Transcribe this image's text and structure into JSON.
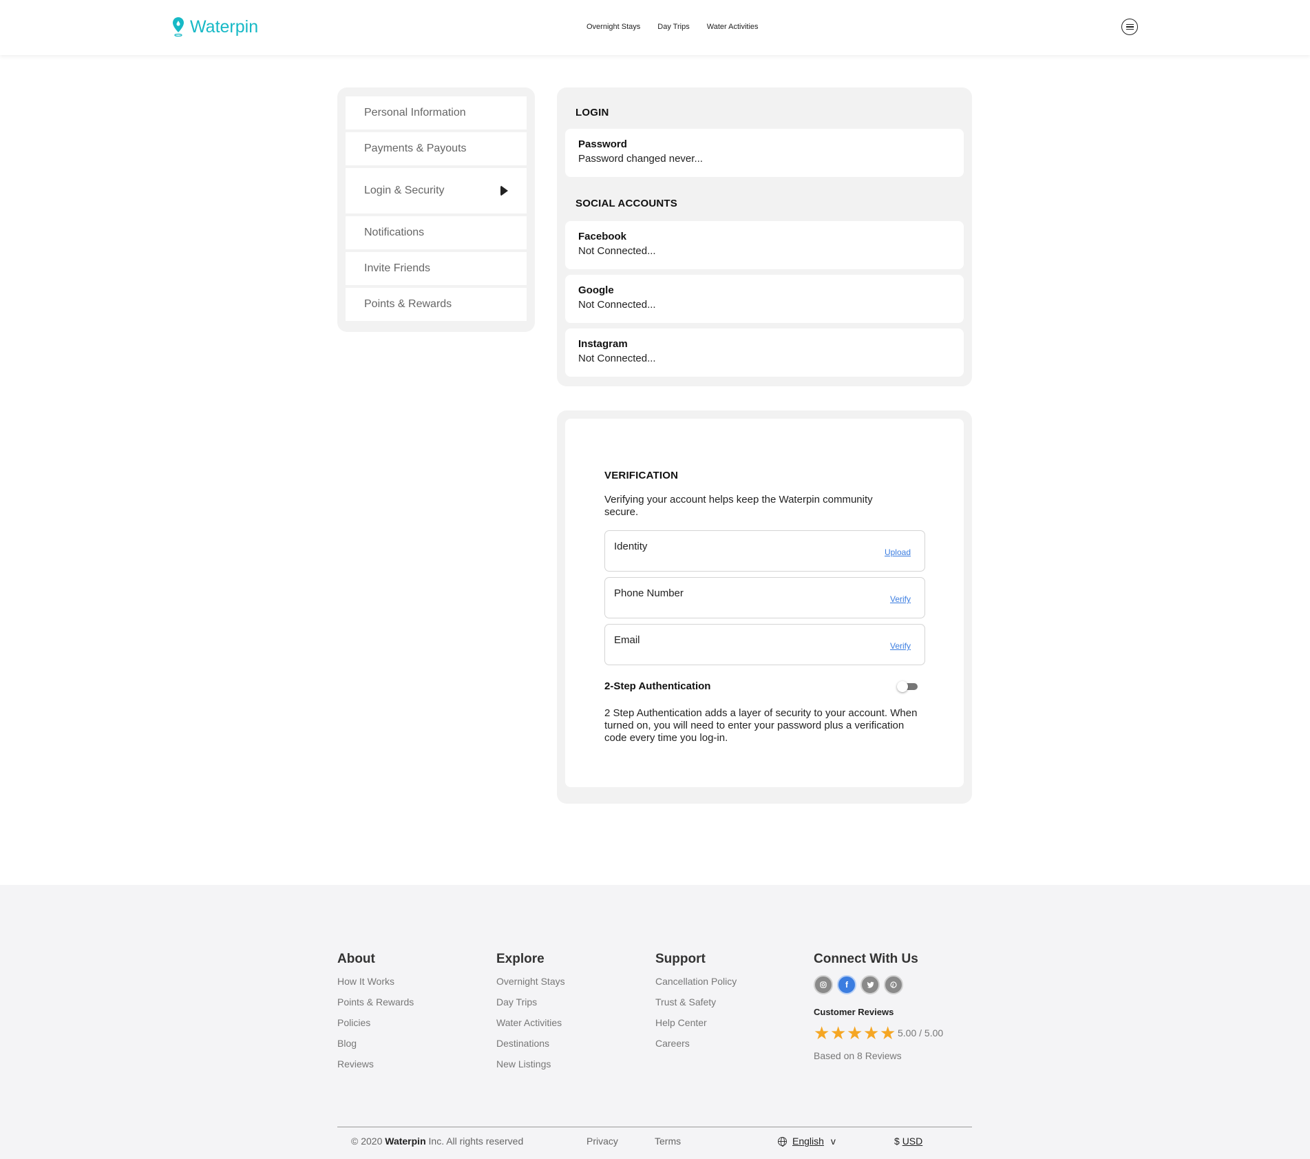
{
  "brand": {
    "name": "Waterpin",
    "accent_color": "#17b9c6"
  },
  "nav": {
    "links": [
      "Overnight Stays",
      "Day Trips",
      "Water Activities"
    ],
    "menu_icon": "hamburger-menu-icon"
  },
  "sidebar": {
    "items": [
      {
        "label": "Personal Information"
      },
      {
        "label": "Payments & Payouts"
      },
      {
        "label": "Login & Security",
        "active": true
      },
      {
        "label": "Notifications"
      },
      {
        "label": "Invite Friends"
      },
      {
        "label": "Points & Rewards"
      }
    ]
  },
  "login": {
    "heading": "LOGIN",
    "password": {
      "title": "Password",
      "status": "Password changed never..."
    },
    "social_heading": "SOCIAL ACCOUNTS",
    "social": [
      {
        "title": "Facebook",
        "status": "Not Connected..."
      },
      {
        "title": "Google",
        "status": "Not Connected..."
      },
      {
        "title": "Instagram",
        "status": "Not Connected..."
      }
    ]
  },
  "verification": {
    "heading": "VERIFICATION",
    "description": "Verifying your account helps keep the Waterpin community secure.",
    "rows": [
      {
        "label": "Identity",
        "action": "Upload"
      },
      {
        "label": "Phone Number",
        "action": "Verify"
      },
      {
        "label": "Email",
        "action": "Verify"
      }
    ],
    "two_step": {
      "title": "2-Step Authentication",
      "enabled": false,
      "description": "2 Step Authentication adds a layer of security to your account. When turned on, you will need to enter your password plus a verification code every time you log-in."
    }
  },
  "footer": {
    "about": {
      "title": "About",
      "links": [
        "How It Works",
        "Points & Rewards",
        "Policies",
        "Blog",
        "Reviews"
      ]
    },
    "explore": {
      "title": "Explore",
      "links": [
        "Overnight Stays",
        "Day Trips",
        "Water Activities",
        "Destinations",
        "New Listings"
      ]
    },
    "support": {
      "title": "Support",
      "links": [
        "Cancellation Policy",
        "Trust & Safety",
        "Help Center",
        "Careers"
      ]
    },
    "connect": {
      "title": "Connect With Us",
      "social_icons": [
        "instagram-icon",
        "facebook-icon",
        "twitter-icon",
        "pinterest-icon"
      ],
      "reviews_title": "Customer Reviews",
      "rating": "5.00 / 5.00",
      "rating_value": 5,
      "star_color": "#f5a623",
      "based_on": "Based on 8 Reviews"
    },
    "copyright_prefix": "© 2020",
    "copyright_brand": "Waterpin",
    "copyright_suffix": "Inc. All rights reserved",
    "privacy": "Privacy",
    "terms": "Terms",
    "language": "English",
    "language_caret": "v",
    "currency_symbol": "$",
    "currency": "USD"
  }
}
